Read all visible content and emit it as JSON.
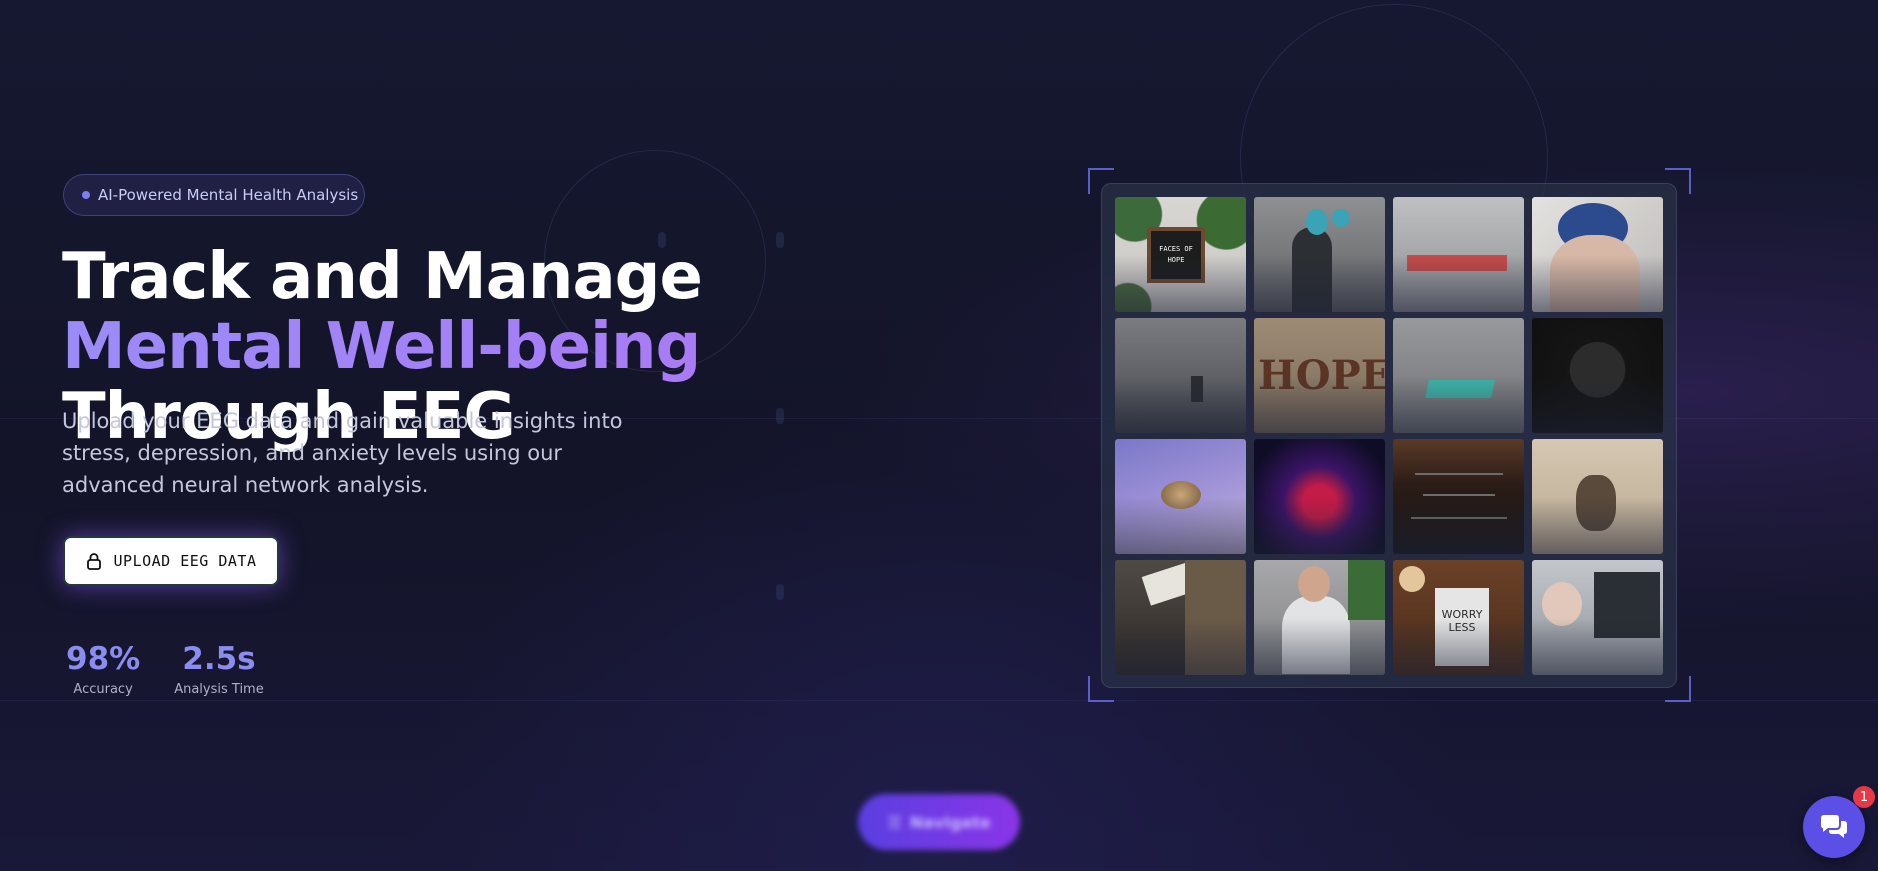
{
  "hero": {
    "badge": "AI-Powered Mental Health Analysis",
    "title_part1": "Track and Manage ",
    "title_accent": "Mental Well-being",
    "title_part2": " Through EEG",
    "subtitle": "Upload your EEG data and gain valuable insights into stress, depression, and anxiety levels using our advanced neural network analysis.",
    "upload_button": "UPLOAD EEG DATA",
    "stats": [
      {
        "value": "98%",
        "label": "Accuracy"
      },
      {
        "value": "2.5s",
        "label": "Analysis Time"
      }
    ]
  },
  "gallery": {
    "tiles": [
      {
        "name": "letter-board-image",
        "caption": "FACES OF HOPE"
      },
      {
        "name": "person-hand-raised-image",
        "caption": ""
      },
      {
        "name": "sign-image",
        "caption": ""
      },
      {
        "name": "person-hair-dye-image",
        "caption": ""
      },
      {
        "name": "person-foggy-sea-image",
        "caption": ""
      },
      {
        "name": "hope-sand-image",
        "caption": "HOPE"
      },
      {
        "name": "road-marking-image",
        "caption": ""
      },
      {
        "name": "person-mask-image",
        "caption": ""
      },
      {
        "name": "brain-model-image",
        "caption": ""
      },
      {
        "name": "plasma-ball-image",
        "caption": ""
      },
      {
        "name": "dark-wood-text-image",
        "caption": ""
      },
      {
        "name": "person-notes-image",
        "caption": ""
      },
      {
        "name": "building-sign-image",
        "caption": ""
      },
      {
        "name": "man-sitting-image",
        "caption": ""
      },
      {
        "name": "worry-less-image",
        "caption": "WORRY LESS"
      },
      {
        "name": "patient-eeg-image",
        "caption": ""
      }
    ]
  },
  "navigate_button": "Navigate",
  "chat": {
    "badge_count": "1"
  },
  "colors": {
    "accent": "#8a8cf0",
    "purple": "#9b8bf7",
    "background": "#141529",
    "chat": "#5b4fe6",
    "badge": "#e53945"
  }
}
